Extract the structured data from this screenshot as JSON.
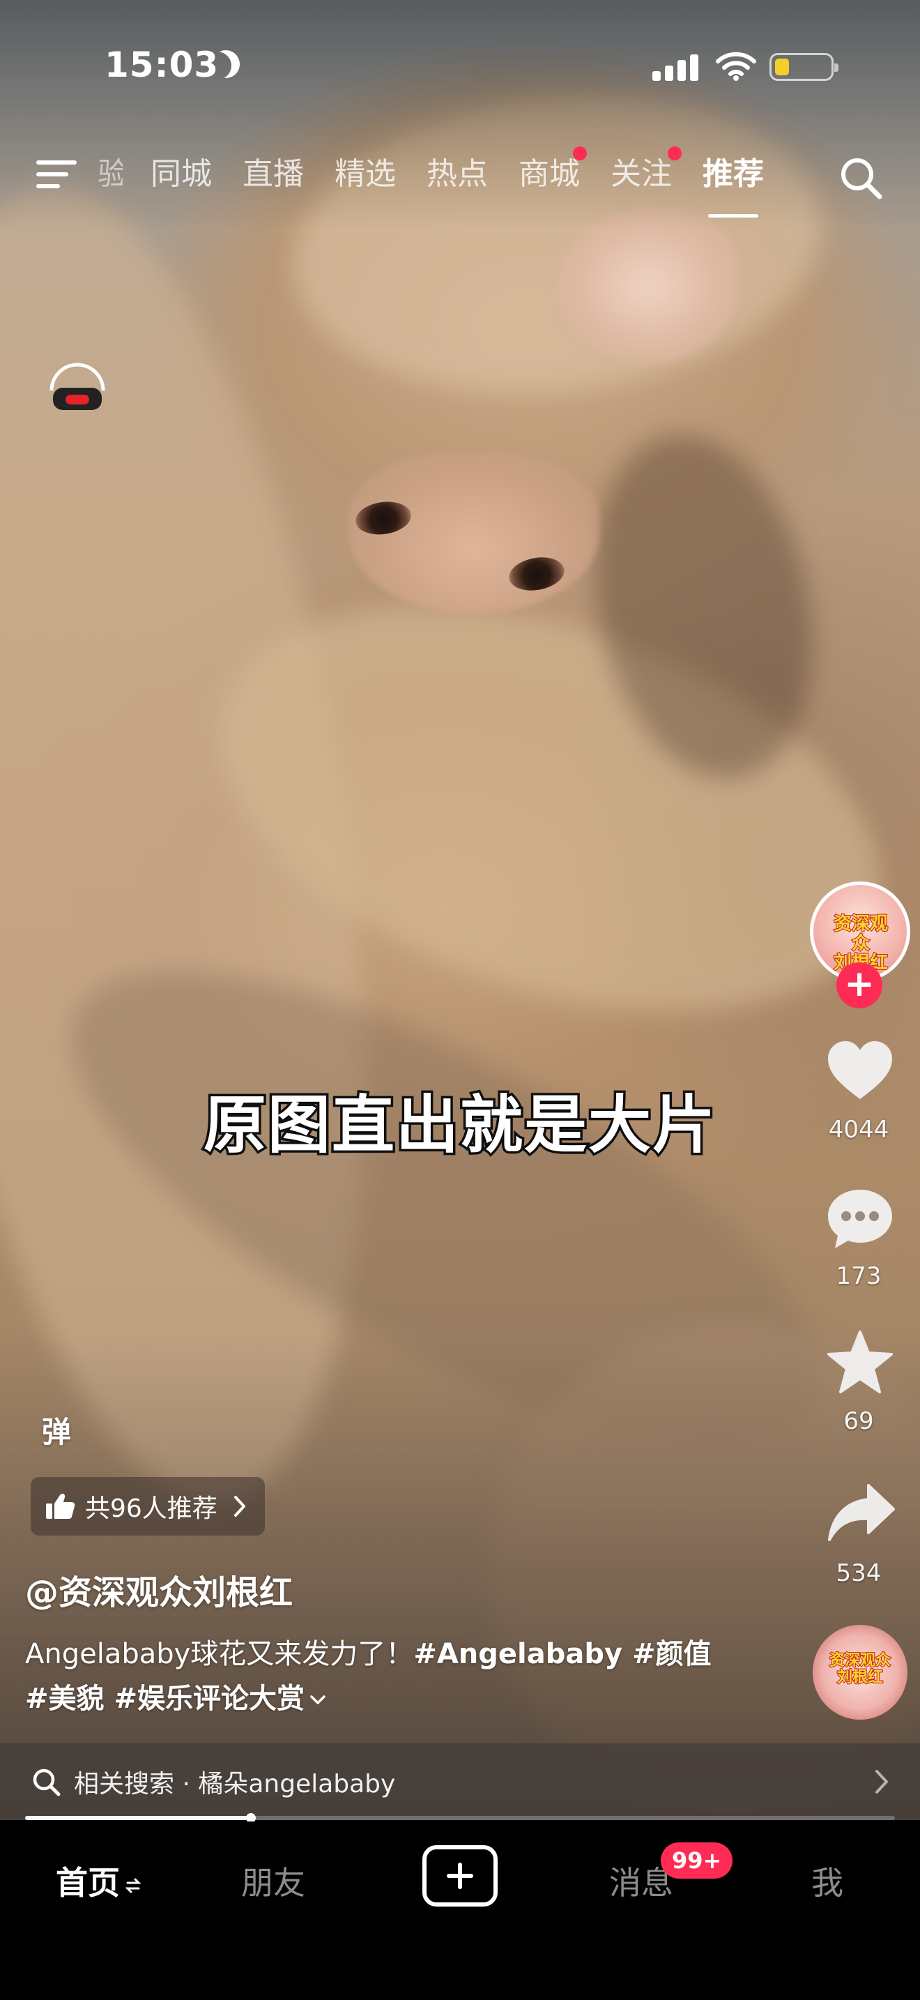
{
  "status_bar": {
    "time": "15:03",
    "battery_color": "#f4cf2a"
  },
  "top_nav": {
    "tabs": [
      {
        "label": "验",
        "state": "partially-hidden"
      },
      {
        "label": "同城"
      },
      {
        "label": "直播"
      },
      {
        "label": "精选"
      },
      {
        "label": "热点"
      },
      {
        "label": "商城",
        "dot": true
      },
      {
        "label": "关注",
        "dot": true
      },
      {
        "label": "推荐",
        "active": true
      }
    ],
    "icons": [
      "menu-icon",
      "search-icon"
    ]
  },
  "video": {
    "caption": "原图直出就是大片"
  },
  "right_rail": {
    "avatar_text": "资深观众 刘根红",
    "follow_symbol": "+",
    "likes": "4044",
    "comments": "173",
    "favorites": "69",
    "shares": "534",
    "icons": [
      "heart-icon",
      "comment-icon",
      "star-icon",
      "share-icon"
    ]
  },
  "info": {
    "danmu_label": "弹",
    "recommend_text": "共96人推荐",
    "author": "@资深观众刘根红",
    "desc_text": "Angelababy球花又来发力了！",
    "tags_line1": "#Angelababy #颜值",
    "tags_line2": "#美貌 #娱乐评论大赏"
  },
  "related_search": {
    "text": "相关搜索 · 橘朵angelababy"
  },
  "progress": {
    "fraction": 0.26
  },
  "tab_bar": {
    "home": "首页",
    "friends": "朋友",
    "messages": "消息",
    "messages_badge": "99+",
    "me": "我"
  },
  "colors": {
    "accent": "#fe2c55"
  }
}
